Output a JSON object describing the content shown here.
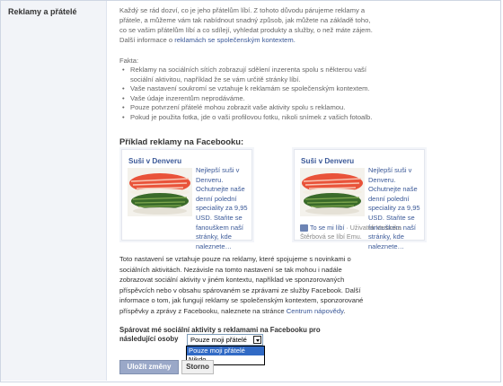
{
  "section": {
    "title": "Reklamy a přátelé"
  },
  "intro": {
    "line1": "Každý se rád dozví, co je jeho přátelům líbí. Z tohoto důvodu párujeme reklamy a",
    "line2": "přátele, a můžeme vám tak nabídnout snadný způsob, jak můžete na základě toho,",
    "line3": "co se vašim přátelům líbí a co sdílejí, vyhledat produkty a služby, o než máte zájem.",
    "line4_prefix": "Další informace o ",
    "line4_link": "reklamách se společenským kontextem."
  },
  "facts": {
    "heading": "Fakta:",
    "items": [
      "Reklamy na sociálních sítích zobrazují sdělení inzerenta spolu s některou vaší",
      "sociální aktivitou, například že se vám určitě stránky líbí.",
      "Vaše nastavení soukromí se vztahuje k reklamám se společenským kontextem.",
      "Vaše údaje inzerentům neprodáváme.",
      "Pouze potvrzení přátelé mohou zobrazit vaše aktivity spolu s reklamou.",
      "Pokud je použita fotka, jde o vaši profilovou fotku, nikoli snímek z vašich fotoalb."
    ]
  },
  "example": {
    "title": "Příklad reklamy na Facebooku:",
    "ads": [
      {
        "title": "Suši v Denveru",
        "text": "Nejlepší suši v Denveru. Ochutnejte naše denní polední speciality za 9,95 USD. Staňte se fanouškem naší stránky, kde naleznete…",
        "like": ""
      },
      {
        "title": "Suši v Denveru",
        "text": "Nejlepší suši v Denveru. Ochutnejte naše denní polední speciality za 9,95 USD. Staňte se fanouškem naší stránky, kde naleznete…",
        "like_link": "To se mi líbí",
        "like": " · Uživateli Veronika Štěrbová se líbí Emu."
      }
    ]
  },
  "explanation": {
    "text": "Toto nastavení se vztahuje pouze na reklamy, které spojujeme s novinkami o sociálních aktivitách. Nezávisle na tomto nastavení se tak mohou i nadále zobrazovat sociální aktivity v jiném kontextu, například ve sponzorovaných příspěvcích nebo v obsahu spárovaném se zprávami ze služby Facebook. Další informace o tom, jak fungují reklamy se společenským kontextem, sponzorované příspěvky a zprávy z Facebooku, naleznete na stránce ",
    "link": "Centrum nápovědy",
    "suffix": "."
  },
  "pairing": {
    "label_line1": "Spárovat mé sociální aktivity s reklamami na Facebooku pro",
    "label_line2": "následující osoby",
    "selected": "Pouze moji přátelé",
    "options": [
      "Pouze moji přátelé",
      "Nikdo"
    ]
  },
  "buttons": {
    "save": "Uložit změny",
    "cancel": "Storno"
  }
}
